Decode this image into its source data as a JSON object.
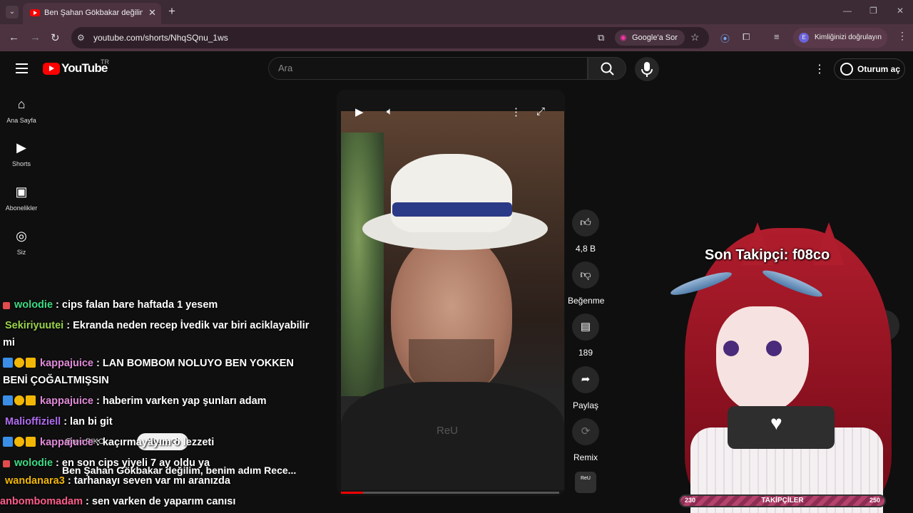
{
  "browser": {
    "tab_title": "Ben Şahan Gökbakar değilim, b",
    "url": "youtube.com/shorts/NhqSQnu_1ws",
    "google_ask": "Google'a Sor",
    "verify_label": "Kimliğinizi doğrulayın",
    "verify_avatar": "E"
  },
  "header": {
    "logo": "YouTube",
    "country": "TR",
    "search_placeholder": "Ara",
    "signin": "Oturum aç"
  },
  "sidebar": {
    "items": [
      {
        "label": "Ana Sayfa",
        "icon": "home-icon"
      },
      {
        "label": "Shorts",
        "icon": "shorts-icon"
      },
      {
        "label": "Abonelikler",
        "icon": "subscriptions-icon"
      },
      {
        "label": "Siz",
        "icon": "account-icon"
      }
    ]
  },
  "short": {
    "channel": "@reu PIKO",
    "subscribe": "Abone ol",
    "title": "Ben Şahan Gökbakar değilim, benim adım Rece...",
    "watermark": "ReU",
    "progress": 0.1
  },
  "actions": {
    "likes": "4,8 B",
    "dislike": "Beğenme",
    "comments": "189",
    "share": "Paylaş",
    "remix": "Remix",
    "audio": "ReU"
  },
  "chat": [
    {
      "user": "wolodie",
      "color": "#3ddc84",
      "text": ": cips falan bare haftada 1 yesem",
      "badges": [
        "#e34c4c"
      ]
    },
    {
      "user": "Sekiriyuutei",
      "color": "#9ad34a",
      "text": ": Ekranda neden recep İvedik var biri aciklayabilir",
      "cont": "mi",
      "badges": []
    },
    {
      "user": "kappajuice",
      "color": "#e08ad8",
      "text": ": LAN BOMBOM NOLUYO BEN YOKKEN",
      "cont": "BENİ ÇOĞALTMIŞSIN",
      "badges": [
        "#3a8ee6",
        "#f2b705",
        "#f2b705"
      ]
    },
    {
      "user": "kappajuice",
      "color": "#e08ad8",
      "text": ": haberim varken yap şunları adam",
      "badges": [
        "#3a8ee6",
        "#f2b705",
        "#f2b705"
      ]
    },
    {
      "user": "Malioffiziell",
      "color": "#b06cf0",
      "text": ": lan bi git",
      "badges": []
    },
    {
      "user": "kappajuice",
      "color": "#e08ad8",
      "text": ": kaçırmayayım o lezzeti",
      "badges": [
        "#3a8ee6",
        "#f2b705",
        "#f2b705"
      ]
    },
    {
      "user": "wolodie",
      "color": "#3ddc84",
      "text": ": en son cips yiyeli 7 ay oldu ya",
      "badges": [
        "#e34c4c"
      ]
    },
    {
      "user": "wandanara3",
      "color": "#f2b705",
      "text": ": tarhanayı seven var mı aranızda",
      "badges": []
    },
    {
      "user": "anbombomadam",
      "color": "#ff5c8a",
      "text": ": sen varken de yaparım canısı",
      "badges": []
    }
  ],
  "overlay": {
    "last_follower": "Son Takipçi: f08co",
    "followers_label": "TAKİPÇİLER",
    "followers_current": "230",
    "followers_goal": "250"
  }
}
